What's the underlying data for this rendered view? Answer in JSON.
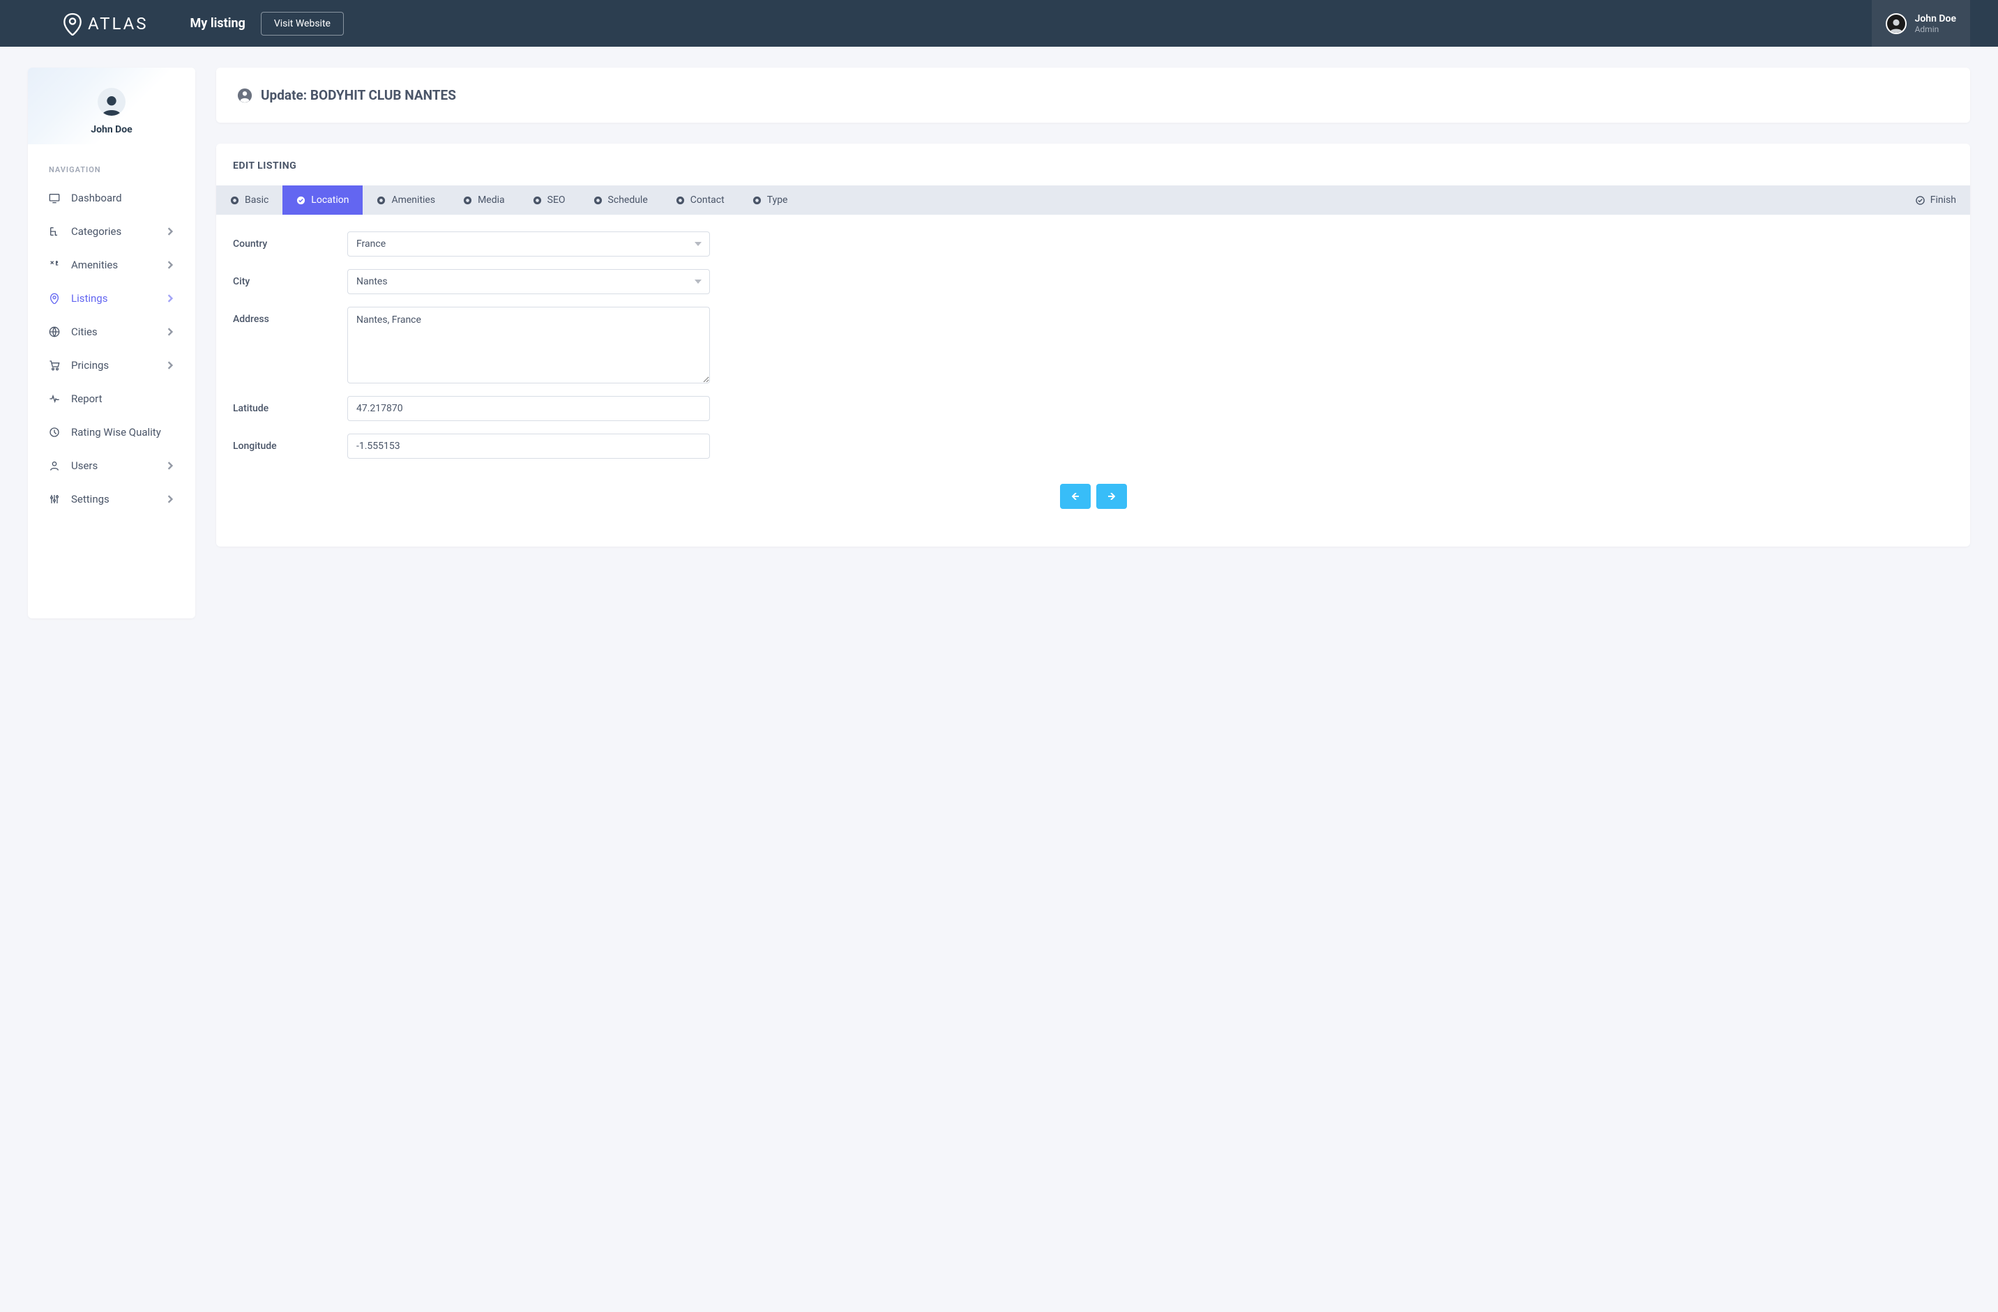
{
  "header": {
    "brand": "ATLAS",
    "title": "My listing",
    "visit_label": "Visit Website",
    "user": {
      "name": "John Doe",
      "role": "Admin"
    }
  },
  "sidebar": {
    "user_name": "John Doe",
    "section_label": "NAVIGATION",
    "items": [
      {
        "label": "Dashboard",
        "has_children": false
      },
      {
        "label": "Categories",
        "has_children": true
      },
      {
        "label": "Amenities",
        "has_children": true
      },
      {
        "label": "Listings",
        "has_children": true,
        "active": true
      },
      {
        "label": "Cities",
        "has_children": true
      },
      {
        "label": "Pricings",
        "has_children": true
      },
      {
        "label": "Report",
        "has_children": false
      },
      {
        "label": "Rating Wise Quality",
        "has_children": false
      },
      {
        "label": "Users",
        "has_children": true
      },
      {
        "label": "Settings",
        "has_children": true
      }
    ]
  },
  "page": {
    "title_prefix": "Update:",
    "title_entity": "BODYHIT CLUB NANTES",
    "card_title": "EDIT LISTING"
  },
  "tabs": [
    {
      "label": "Basic"
    },
    {
      "label": "Location",
      "active": true
    },
    {
      "label": "Amenities"
    },
    {
      "label": "Media"
    },
    {
      "label": "SEO"
    },
    {
      "label": "Schedule"
    },
    {
      "label": "Contact"
    },
    {
      "label": "Type"
    },
    {
      "label": "Finish",
      "finish": true
    }
  ],
  "form": {
    "country": {
      "label": "Country",
      "value": "France"
    },
    "city": {
      "label": "City",
      "value": "Nantes"
    },
    "address": {
      "label": "Address",
      "value": "Nantes, France"
    },
    "latitude": {
      "label": "Latitude",
      "value": "47.217870"
    },
    "longitude": {
      "label": "Longitude",
      "value": "-1.555153"
    }
  }
}
